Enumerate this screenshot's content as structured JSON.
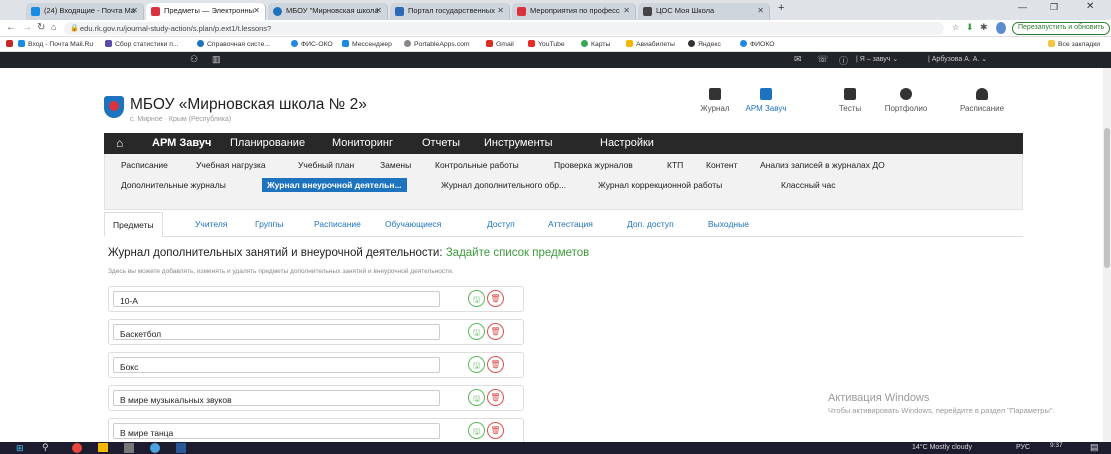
{
  "browser": {
    "tabs": [
      {
        "label": "(24) Входящие - Почта Ma",
        "color": "#168de2"
      },
      {
        "label": "Предметы — Электронны",
        "color": "#d9333f"
      },
      {
        "label": "МБОУ \"Мирновская школа",
        "color": "#1e73be"
      },
      {
        "label": "Портал государственных",
        "color": "#2b6ab6"
      },
      {
        "label": "Мероприятия по професс",
        "color": "#d9333f"
      },
      {
        "label": "ЦОС Моя Школа",
        "color": "#444444"
      }
    ],
    "url": "edu.rk.gov.ru/journal-study-action/s.plan/p.ext1/t.lessons?",
    "restart_label": "Перезапустить и обновить",
    "bookmarks": [
      "Вход - Почта Mail.Ru",
      "Сбор статистики п...",
      "Справочная систе...",
      "ФИС-ОКО",
      "Мессенджер",
      "PortableApps.com",
      "Gmail",
      "YouTube",
      "Карты",
      "Авиабилеты",
      "Яндекс",
      "ФИОКО"
    ],
    "all_bookmarks": "Все закладки"
  },
  "sitebar": {
    "role": "Я – завуч",
    "user": "Арбузова А. А."
  },
  "school": {
    "name": "МБОУ «Мирновская школа № 2»",
    "location": "с. Мирное · Крым (Республика)"
  },
  "top_nav": [
    "Журнал",
    "АРМ Завуч",
    "Тесты",
    "Портфолио",
    "Расписание"
  ],
  "menu": [
    "АРМ Завуч",
    "Планирование",
    "Мониторинг",
    "Отчеты",
    "Инструменты",
    "Настройки"
  ],
  "submenu_row1": [
    "Расписание",
    "Учебная нагрузка",
    "Учебный план",
    "Замены",
    "Контрольные работы",
    "Проверка журналов",
    "КТП",
    "Контент",
    "Анализ записей в журналах ДО"
  ],
  "submenu_row2": [
    "Дополнительные журналы",
    "Журнал внеурочной деятельн...",
    "Журнал дополнительного обр...",
    "Журнал коррекционной работы",
    "Классный час"
  ],
  "tabs": [
    "Предметы",
    "Учителя",
    "Группы",
    "Расписание",
    "Обучающиеся",
    "Доступ",
    "Аттестация",
    "Доп. доступ",
    "Выходные"
  ],
  "page": {
    "title": "Журнал дополнительных занятий и внеурочной деятельности:",
    "title_accent": "Задайте список предметов",
    "description": "Здесь вы можете добавлять, изменять и удалять предметы дополнительных занятий и внеурочной деятельности."
  },
  "subjects": [
    "10-А",
    "Баскетбол",
    "Бокс",
    "В мире музыкальных звуков",
    "В мире танца"
  ],
  "activation": {
    "title": "Активация Windows",
    "text": "Чтобы активировать Windows, перейдите в раздел \"Параметры\"."
  },
  "taskbar": {
    "weather": "14°C  Mostly cloudy",
    "lang": "РУС",
    "time": "9:37"
  },
  "colors": {
    "accent": "#1e73be",
    "menu_bg": "#282828",
    "green": "#3c9a3c",
    "red": "#d9534f"
  }
}
